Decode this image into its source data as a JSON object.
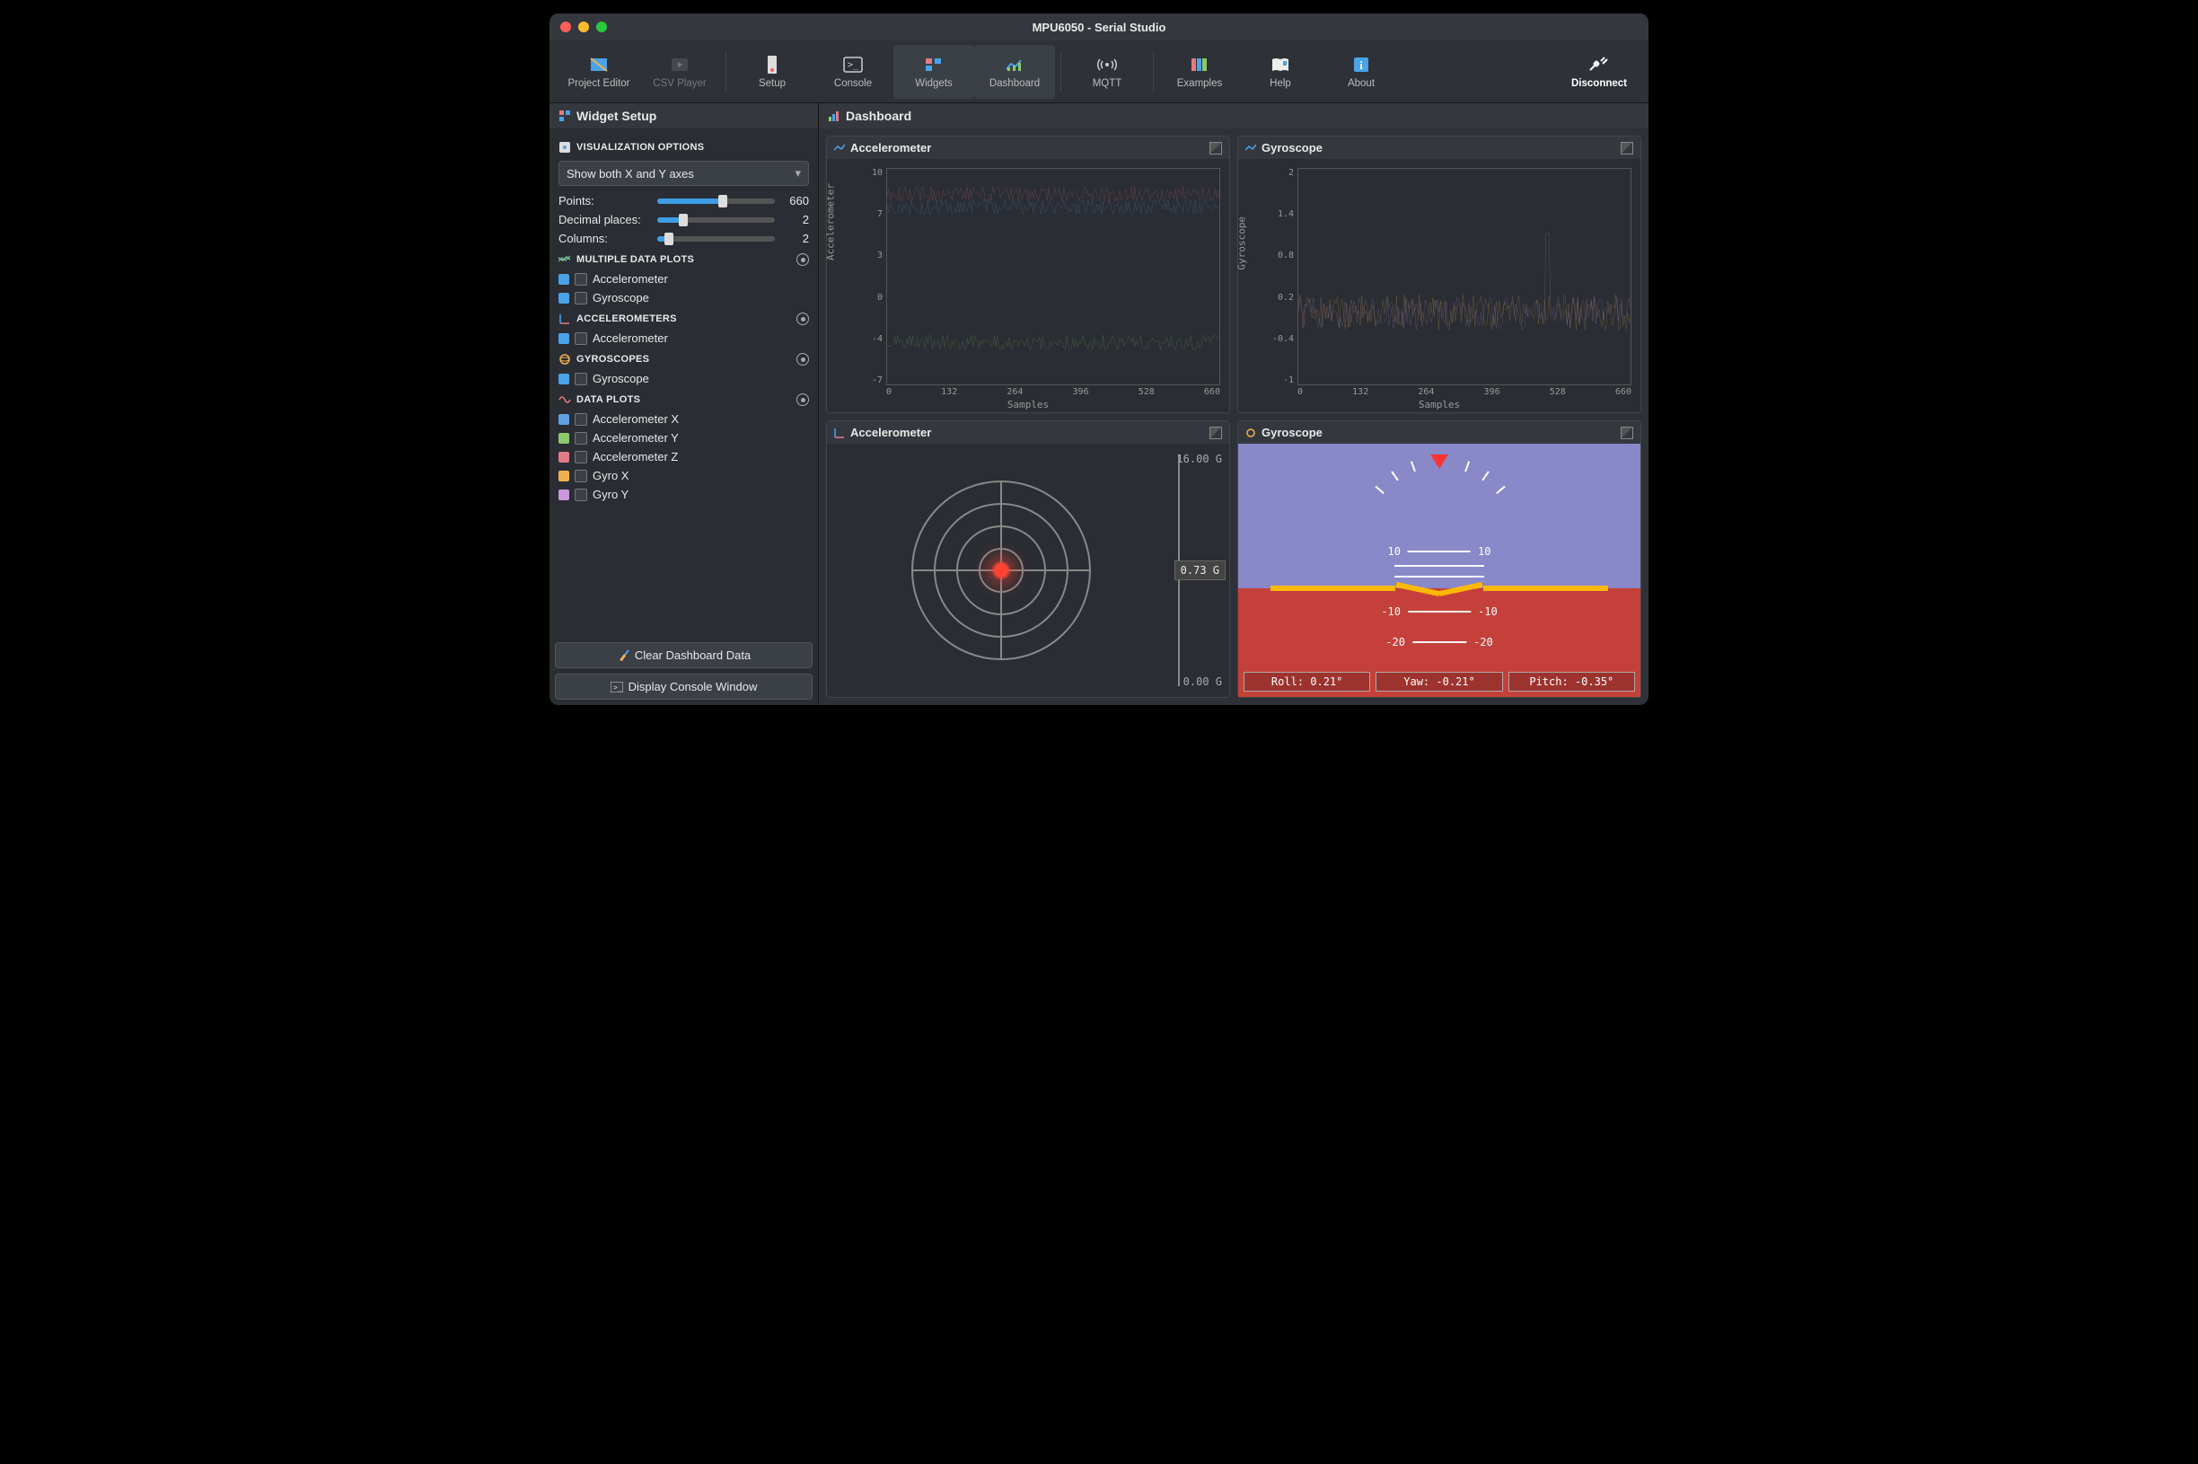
{
  "window_title": "MPU6050 - Serial Studio",
  "toolbar": {
    "project_editor": "Project Editor",
    "csv_player": "CSV Player",
    "setup": "Setup",
    "console": "Console",
    "widgets": "Widgets",
    "dashboard": "Dashboard",
    "mqtt": "MQTT",
    "examples": "Examples",
    "help": "Help",
    "about": "About",
    "disconnect": "Disconnect"
  },
  "sidebar": {
    "title": "Widget Setup",
    "viz_options": "VISUALIZATION OPTIONS",
    "axis_mode": "Show both X and Y axes",
    "points_label": "Points:",
    "points_value": "660",
    "decimals_label": "Decimal places:",
    "decimals_value": "2",
    "columns_label": "Columns:",
    "columns_value": "2",
    "multi_plots": "MULTIPLE DATA PLOTS",
    "accelerometers": "ACCELEROMETERS",
    "gyroscopes": "GYROSCOPES",
    "data_plots": "DATA PLOTS",
    "items": {
      "accel": "Accelerometer",
      "gyro": "Gyroscope",
      "ax": "Accelerometer X",
      "ay": "Accelerometer Y",
      "az": "Accelerometer Z",
      "gx": "Gyro X",
      "gy": "Gyro Y"
    },
    "colors": {
      "accel": "#4aa3e8",
      "gyro": "#4aa3e8",
      "ax": "#5ea0e0",
      "ay": "#8cc96a",
      "az": "#e27b88",
      "gx": "#f0b050",
      "gy": "#c998dd"
    },
    "clear": "Clear Dashboard Data",
    "console_btn": "Display Console Window"
  },
  "dashboard_title": "Dashboard",
  "cards": {
    "accel_plot": "Accelerometer",
    "gyro_plot": "Gyroscope",
    "accel_widget": "Accelerometer",
    "gyro_widget": "Gyroscope"
  },
  "accel_g": {
    "max": "16.00 G",
    "min": "0.00 G",
    "value": "0.73 G"
  },
  "attitude": {
    "roll": "Roll: 0.21°",
    "yaw": "Yaw: -0.21°",
    "pitch": "Pitch: -0.35°"
  },
  "chart_data": [
    {
      "type": "line",
      "title": "Accelerometer",
      "xlabel": "Samples",
      "ylabel": "Accelerometer",
      "xlim": [
        0,
        660
      ],
      "ylim": [
        -7,
        10
      ],
      "xticks": [
        0,
        132,
        264,
        396,
        528,
        660
      ],
      "yticks": [
        10,
        7,
        3,
        0,
        -4,
        -7
      ],
      "series": [
        {
          "name": "Accelerometer Z",
          "color": "#e27b88",
          "approx_mean": 8.0
        },
        {
          "name": "Accelerometer X",
          "color": "#5ea0e0",
          "approx_mean": 7.0
        },
        {
          "name": "Accelerometer Y",
          "color": "#8cc96a",
          "approx_mean": -3.7
        }
      ]
    },
    {
      "type": "line",
      "title": "Gyroscope",
      "xlabel": "Samples",
      "ylabel": "Gyroscope",
      "xlim": [
        0,
        660
      ],
      "ylim": [
        -1.0,
        2.0
      ],
      "xticks": [
        0,
        132,
        264,
        396,
        528,
        660
      ],
      "yticks": [
        2.0,
        1.4,
        0.8,
        0.2,
        -0.4,
        -1.0
      ],
      "series": [
        {
          "name": "Gyro X",
          "color": "#f0b050",
          "approx_mean": 0.0
        },
        {
          "name": "Gyro Y",
          "color": "#c998dd",
          "approx_mean": 0.0
        }
      ]
    }
  ]
}
